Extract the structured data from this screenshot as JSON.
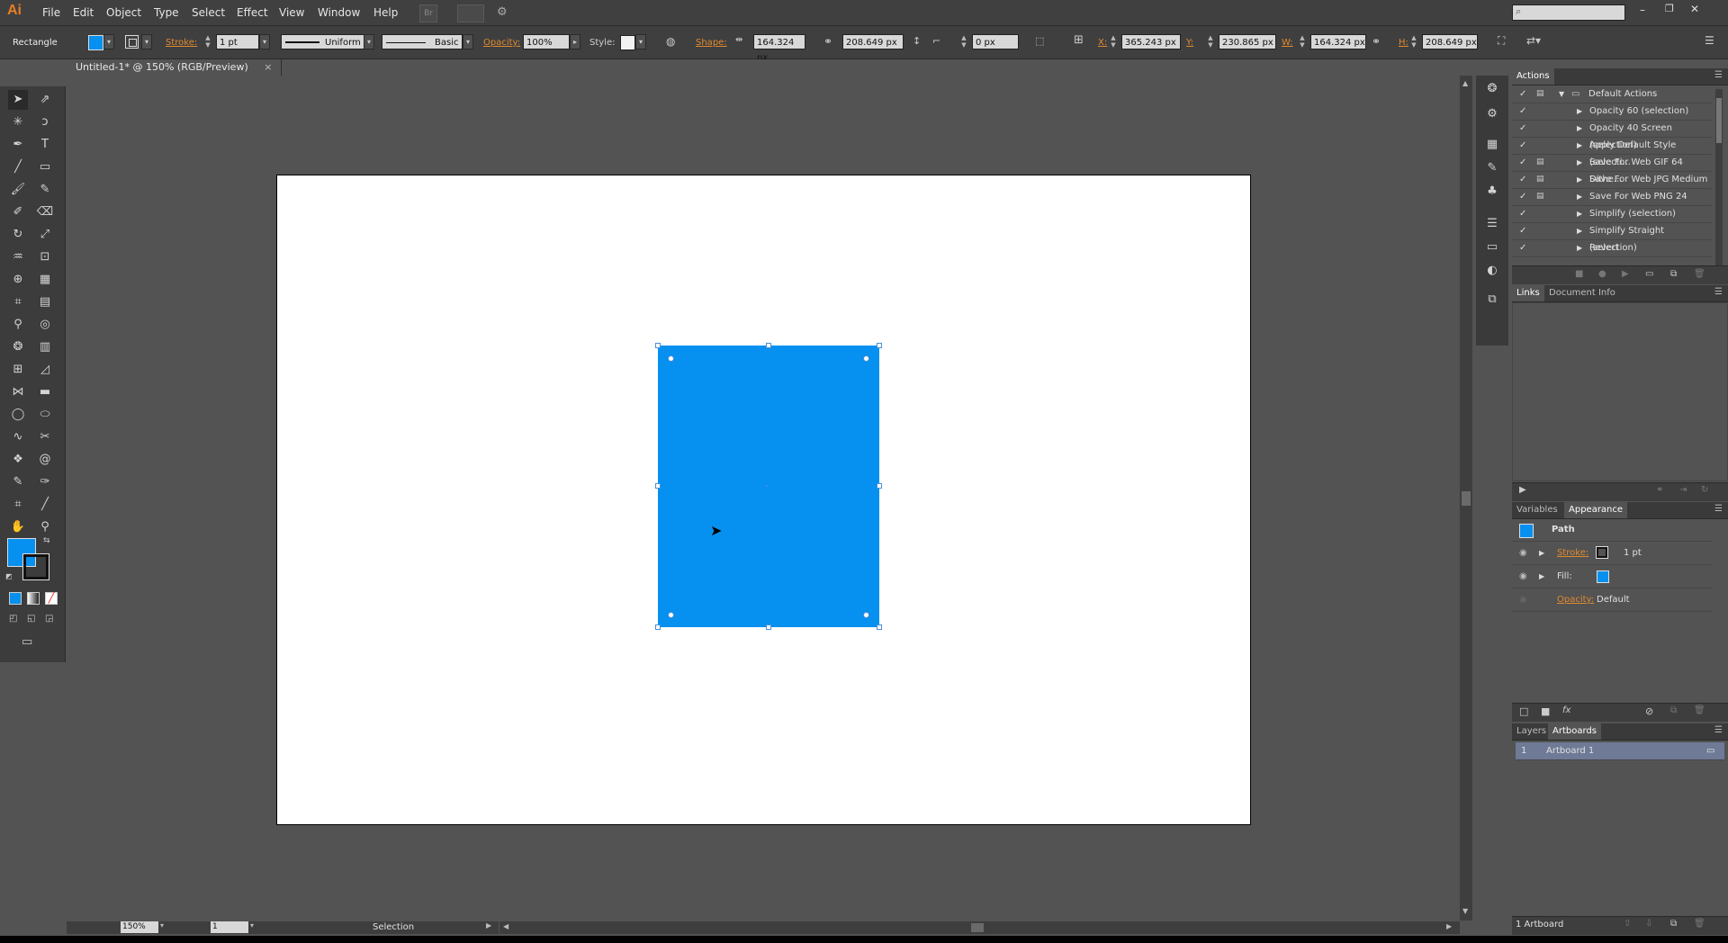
{
  "app": {
    "logo": "Ai",
    "accent": "#e67e22"
  },
  "menu": [
    "File",
    "Edit",
    "Object",
    "Type",
    "Select",
    "Effect",
    "View",
    "Window",
    "Help"
  ],
  "menu_extra": {
    "bridge": "Br"
  },
  "control": {
    "tool_name": "Rectangle",
    "stroke_label": "Stroke:",
    "stroke_weight": "1 pt",
    "stroke_profile": "Uniform",
    "brush": "Basic",
    "opacity_label": "Opacity:",
    "opacity_value": "100%",
    "style_label": "Style:",
    "shape_label": "Shape:",
    "shape_w": "164.324 px",
    "shape_h": "208.649 px",
    "corner": "0 px",
    "x_label": "X:",
    "x_value": "365.243 px",
    "y_label": "Y:",
    "y_value": "230.865 px",
    "w_label": "W:",
    "w_value": "164.324 px",
    "h_label": "H:",
    "h_value": "208.649 px"
  },
  "document": {
    "tab_title": "Untitled-1* @ 150% (RGB/Preview)",
    "fill_color": "#0690ef"
  },
  "status": {
    "zoom": "150%",
    "artboard_num": "1",
    "tool": "Selection"
  },
  "actions_panel": {
    "title": "Actions",
    "items": [
      {
        "label": "Default Actions",
        "folder": true
      },
      {
        "label": "Opacity 60 (selection)"
      },
      {
        "label": "Opacity 40 Screen (selection)"
      },
      {
        "label": "Apply Default Style (selecti..."
      },
      {
        "label": "Save For Web GIF 64 Dithe..."
      },
      {
        "label": "Save For Web JPG Medium"
      },
      {
        "label": "Save For Web PNG 24"
      },
      {
        "label": "Simplify (selection)"
      },
      {
        "label": "Simplify Straight (selection)"
      },
      {
        "label": "Revert"
      }
    ]
  },
  "links_panel": {
    "tab1": "Links",
    "tab2": "Document Info"
  },
  "appearance_panel": {
    "tab1": "Variables",
    "tab2": "Appearance",
    "object": "Path",
    "stroke_label": "Stroke:",
    "stroke_value": "1 pt",
    "fill_label": "Fill:",
    "opacity_label": "Opacity:",
    "opacity_value": "Default"
  },
  "artboards_panel": {
    "tab1": "Layers",
    "tab2": "Artboards",
    "rows": [
      {
        "num": "1",
        "name": "Artboard 1"
      }
    ],
    "footer": "1 Artboard"
  }
}
